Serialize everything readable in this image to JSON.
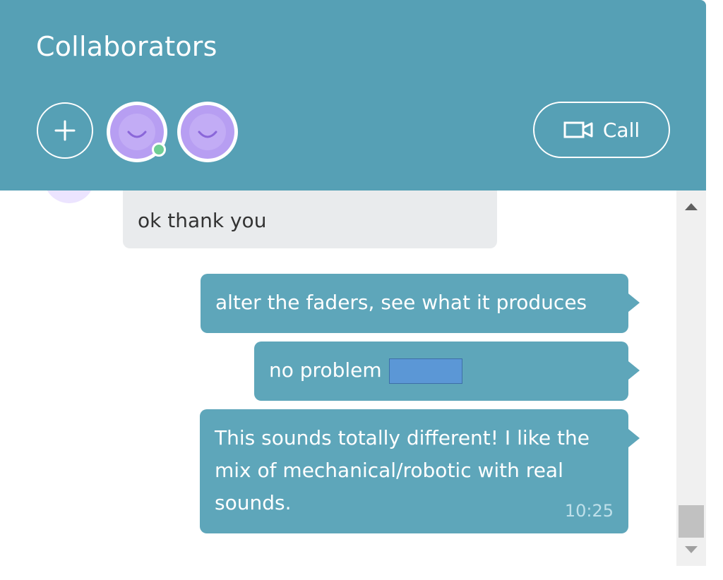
{
  "header": {
    "title": "Collaborators",
    "add_icon": "plus-icon",
    "avatars": [
      {
        "icon": "smile-avatar-icon",
        "online": true
      },
      {
        "icon": "smile-avatar-icon",
        "online": false
      }
    ],
    "call": {
      "label": "Call",
      "icon": "video-camera-icon"
    }
  },
  "messages": [
    {
      "direction": "incoming",
      "text": "ok thank you"
    },
    {
      "direction": "outgoing",
      "text": "alter the faders, see what it produces"
    },
    {
      "direction": "outgoing",
      "text": "no problem"
    },
    {
      "direction": "outgoing",
      "text": "This sounds totally different! I like the mix of mechanical/robotic with real sounds.",
      "time": "10:25"
    }
  ],
  "colors": {
    "header_bg": "#56a0b5",
    "outgoing_bubble": "#5ea6ba",
    "incoming_bubble": "#e9ebed",
    "avatar": "#b79ef2",
    "online": "#6fce95"
  }
}
